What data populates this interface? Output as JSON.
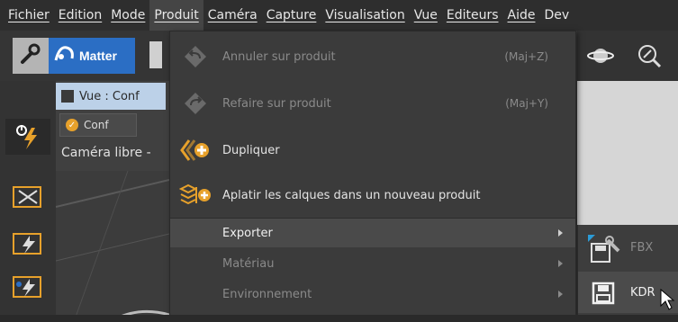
{
  "menubar": {
    "items": [
      "Fichier",
      "Edition",
      "Mode",
      "Produit",
      "Caméra",
      "Capture",
      "Visualisation",
      "Vue",
      "Editeurs",
      "Aide",
      "Dev"
    ],
    "active_index": 3
  },
  "toolbar": {
    "matter_label": "Matter",
    "matter_color": "#2b6ec4"
  },
  "view": {
    "tab_label": "Vue : Conf",
    "conf_label": "Conf",
    "camera_label": "Caméra libre -"
  },
  "dropdown": {
    "items": [
      {
        "label": "Annuler sur produit",
        "shortcut": "(Maj+Z)",
        "icon": "undo-icon",
        "enabled": false
      },
      {
        "label": "Refaire sur produit",
        "shortcut": "(Maj+Y)",
        "icon": "redo-icon",
        "enabled": false
      },
      {
        "label": "Dupliquer",
        "shortcut": "",
        "icon": "duplicate-icon",
        "enabled": true
      },
      {
        "label": "Aplatir les calques dans un nouveau produit",
        "shortcut": "",
        "icon": "flatten-layers-icon",
        "enabled": true
      }
    ],
    "submenus": [
      {
        "label": "Exporter",
        "enabled": true,
        "highlighted": true
      },
      {
        "label": "Matériau",
        "enabled": false,
        "highlighted": false
      },
      {
        "label": "Environnement",
        "enabled": false,
        "highlighted": false
      }
    ]
  },
  "export_submenu": {
    "items": [
      {
        "label": "FBX",
        "icon": "fbx-export-icon",
        "enabled": false
      },
      {
        "label": "KDR",
        "icon": "save-icon",
        "enabled": true,
        "hovered": true
      }
    ]
  },
  "colors": {
    "accent_orange": "#e7a12b",
    "tab_blue": "#bcd1e8"
  }
}
